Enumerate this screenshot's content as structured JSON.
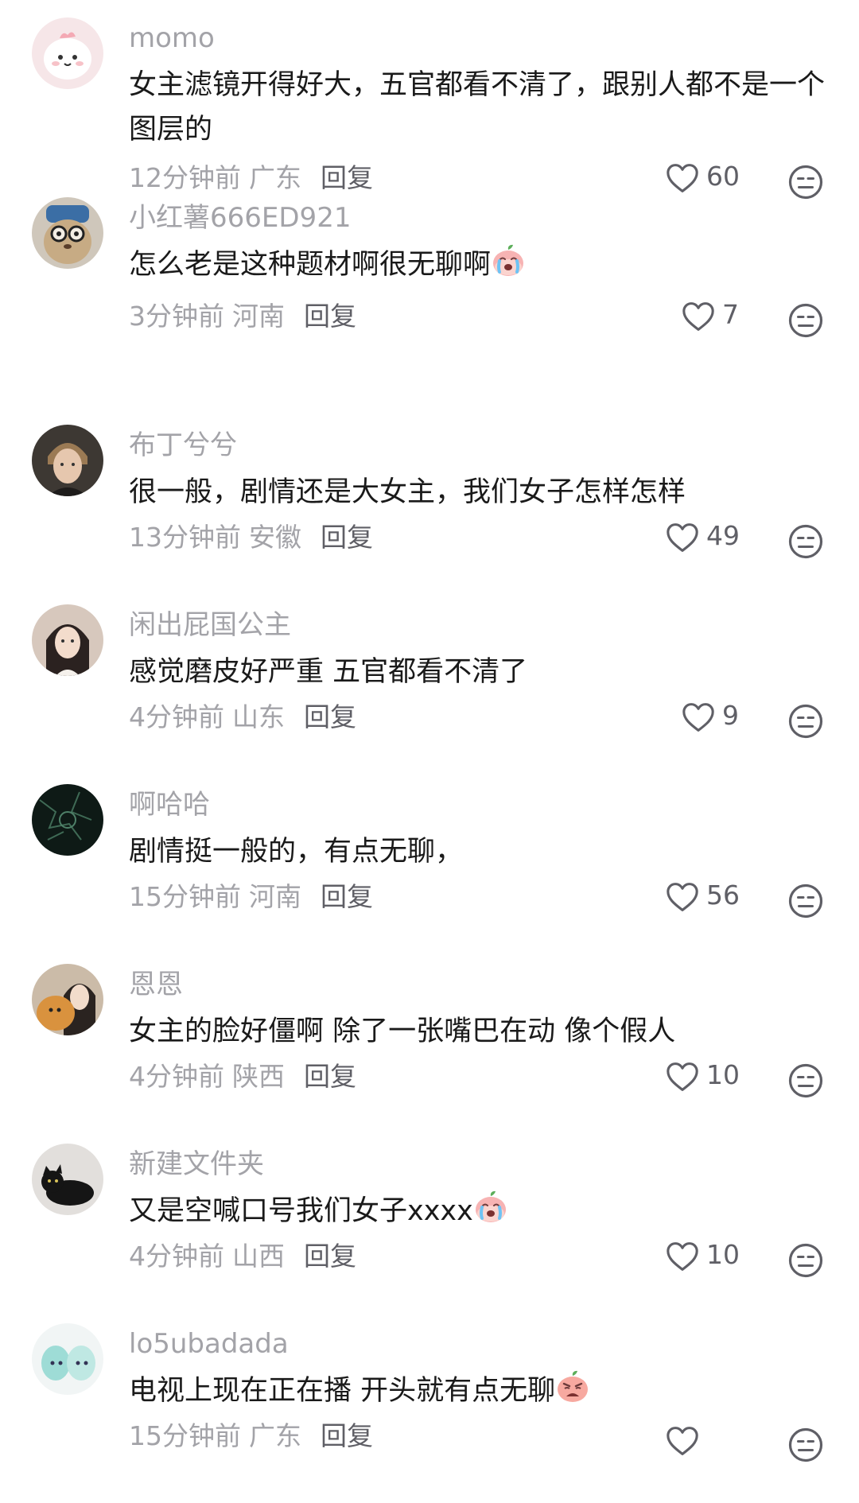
{
  "reply_label": "回复",
  "comments": [
    {
      "user": "momo",
      "text": "女主滤镜开得好大，五官都看不清了，跟别人都不是一个图层的",
      "emoji": "",
      "time": "12分钟前",
      "location": "广东",
      "likes": "60",
      "avatar_icon": "pink-cartoon-avatar-icon"
    },
    {
      "user": "小红薯666ED921",
      "text": "怎么老是这种题材啊很无聊啊",
      "emoji": "crying-peach-emoji",
      "time": "3分钟前",
      "location": "河南",
      "likes": "7",
      "avatar_icon": "dog-with-glasses-avatar-icon"
    },
    {
      "user": "布丁兮兮",
      "text": "很一般，剧情还是大女主，我们女子怎样怎样",
      "emoji": "",
      "time": "13分钟前",
      "location": "安徽",
      "likes": "49",
      "avatar_icon": "man-portrait-avatar-icon"
    },
    {
      "user": "闲出屁国公主",
      "text": "感觉磨皮好严重 五官都看不清了",
      "emoji": "",
      "time": "4分钟前",
      "location": "山东",
      "likes": "9",
      "avatar_icon": "girl-portrait-avatar-icon"
    },
    {
      "user": "啊哈哈",
      "text": "剧情挺一般的，有点无聊，",
      "emoji": "",
      "time": "15分钟前",
      "location": "河南",
      "likes": "56",
      "avatar_icon": "dark-green-pattern-avatar-icon"
    },
    {
      "user": "恩恩",
      "text": "女主的脸好僵啊 除了一张嘴巴在动 像个假人",
      "emoji": "",
      "time": "4分钟前",
      "location": "陕西",
      "likes": "10",
      "avatar_icon": "girl-with-dog-avatar-icon"
    },
    {
      "user": "新建文件夹",
      "text": "又是空喊口号我们女子xxxx",
      "emoji": "crying-peach-emoji",
      "time": "4分钟前",
      "location": "山西",
      "likes": "10",
      "avatar_icon": "black-cat-avatar-icon"
    },
    {
      "user": "lo5ubadada",
      "text": "电视上现在正在播  开头就有点无聊",
      "emoji": "angry-peach-emoji",
      "time": "15分钟前",
      "location": "广东",
      "likes": "",
      "avatar_icon": "anime-characters-avatar-icon"
    }
  ],
  "colors": {
    "secondary_text": "#a3a3a8",
    "primary_text": "#1a1a1a",
    "icon_gray": "#5f5f66"
  }
}
